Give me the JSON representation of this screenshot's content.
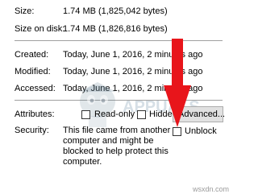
{
  "properties": {
    "size": {
      "label": "Size:",
      "value": "1.74 MB (1,825,042 bytes)"
    },
    "size_on_disk": {
      "label": "Size on disk:",
      "value": "1.74 MB (1,826,816 bytes)"
    },
    "created": {
      "label": "Created:",
      "value": "Today, June 1, 2016, 2 minutes ago"
    },
    "modified": {
      "label": "Modified:",
      "value": "Today, June 1, 2016, 2 minutes ago"
    },
    "accessed": {
      "label": "Accessed:",
      "value": "Today, June 1, 2016, 2 minutes ago"
    }
  },
  "attributes": {
    "label": "Attributes:",
    "read_only": {
      "label": "Read-only",
      "checked": false
    },
    "hidden": {
      "label": "Hidden",
      "checked": false
    },
    "advanced_button": "Advanced..."
  },
  "security": {
    "label": "Security:",
    "text": "This file came from another computer and might be blocked to help protect this computer.",
    "unblock": {
      "label": "Unblock",
      "checked": false
    }
  },
  "overlay": {
    "watermark_text": "APPUALS",
    "arrow_color": "#e8151b"
  },
  "footer_watermark": "wsxdn.com"
}
